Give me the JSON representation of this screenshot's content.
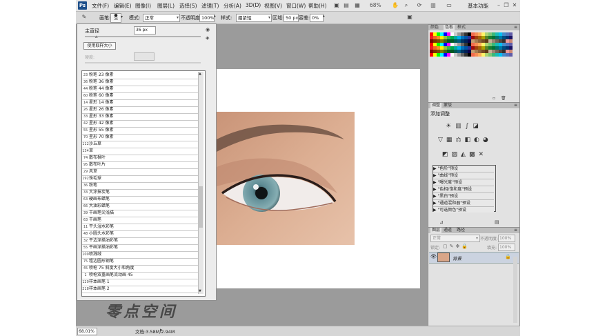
{
  "menubar": {
    "logo": "Ps",
    "items": [
      "文件(F)",
      "编辑(E)",
      "图像(I)",
      "图层(L)",
      "选择(S)",
      "滤镜(T)",
      "分析(A)",
      "3D(D)",
      "视图(V)",
      "窗口(W)",
      "帮助(H)"
    ],
    "zoom": "68%",
    "workspace": "基本功能"
  },
  "options": {
    "brush_label": "画笔:",
    "brush_size": "36",
    "mode_label": "模式:",
    "mode_value": "正常",
    "opacity_label": "不透明度:",
    "opacity_value": "100%",
    "style_label": "样式:",
    "style_value": "绷紧短",
    "area_label": "区域:",
    "area_value": "50 px",
    "tolerance_label": "容差:",
    "tolerance_value": "0%"
  },
  "brush_panel": {
    "diameter_label": "主直径",
    "diameter_value": "36 px",
    "use_sample_button": "使用取样大小",
    "hardness_label": "硬度:",
    "items": [
      {
        "icon": "23",
        "label": "粉笔 23 像素"
      },
      {
        "icon": "36",
        "label": "粉笔 36 像素"
      },
      {
        "icon": "44",
        "label": "粉笔 44 像素"
      },
      {
        "icon": "60",
        "label": "粉笔 60 像素"
      },
      {
        "icon": "14",
        "label": "星形 14 像素"
      },
      {
        "icon": "26",
        "label": "星形 26 像素"
      },
      {
        "icon": "33",
        "label": "星形 33 像素"
      },
      {
        "icon": "42",
        "label": "星形 42 像素"
      },
      {
        "icon": "55",
        "label": "星形 55 像素"
      },
      {
        "icon": "70",
        "label": "星形 70 像素"
      },
      {
        "icon": "112",
        "label": "沙丘草"
      },
      {
        "icon": "134",
        "label": "草"
      },
      {
        "icon": "74",
        "label": "散布枫叶"
      },
      {
        "icon": "95",
        "label": "散布叶片"
      },
      {
        "icon": "29",
        "label": "风草"
      },
      {
        "icon": "192",
        "label": "珠毛球"
      },
      {
        "icon": "36",
        "label": "粉笔"
      },
      {
        "icon": "33",
        "label": "大涂抹炭笔"
      },
      {
        "icon": "63",
        "label": "硬画布蜡笔"
      },
      {
        "icon": "66",
        "label": "大油彩蜡笔"
      },
      {
        "icon": "39",
        "label": "干画笔尖浅描"
      },
      {
        "icon": "63",
        "label": "干画笔"
      },
      {
        "icon": "11",
        "label": "平头湿水彩笔"
      },
      {
        "icon": "48",
        "label": "小圆头水彩笔"
      },
      {
        "icon": "32",
        "label": "干边深描油彩笔"
      },
      {
        "icon": "55",
        "label": "干画深描油彩笔"
      },
      {
        "icon": "100",
        "label": "喷溅绒"
      },
      {
        "icon": "75",
        "label": "粗边圆形钢笔"
      },
      {
        "icon": "45",
        "label": "喷枪 75 斜度大小和角度"
      },
      {
        "icon": "1",
        "label": "喷枪双重画笔流动画 45"
      },
      {
        "icon": "120",
        "label": "样本画笔 1"
      },
      {
        "icon": "218",
        "label": "样本画笔 2"
      }
    ]
  },
  "right_panels": {
    "swatches_tabs": [
      "颜色",
      "色板",
      "样式"
    ],
    "adjust_tabs": [
      "调整",
      "蒙版"
    ],
    "adjust_title": "添加调整",
    "presets": [
      "\"色阶\"预设",
      "\"曲线\"预设",
      "\"曝光度\"预设",
      "\"色相/饱和度\"预设",
      "\"黑白\"预设",
      "\"通道混和器\"预设",
      "\"可选颜色\"预设"
    ],
    "layers_tabs": [
      "图层",
      "通道",
      "路径"
    ],
    "blend_mode": "正常",
    "opacity_label": "不透明度:",
    "opacity_value": "100%",
    "lock_label": "锁定:",
    "fill_label": "填充:",
    "fill_value": "100%",
    "layer_name": "背景"
  },
  "status": {
    "zoom": "68.01%",
    "doc": "文档:3.58M/2.94M"
  },
  "watermark": "零点空间",
  "colors": {
    "menubar": "#e6e6e6",
    "workspace": "#9b9b9b",
    "panel": "#ececec",
    "accent": "#1d4f8a"
  }
}
